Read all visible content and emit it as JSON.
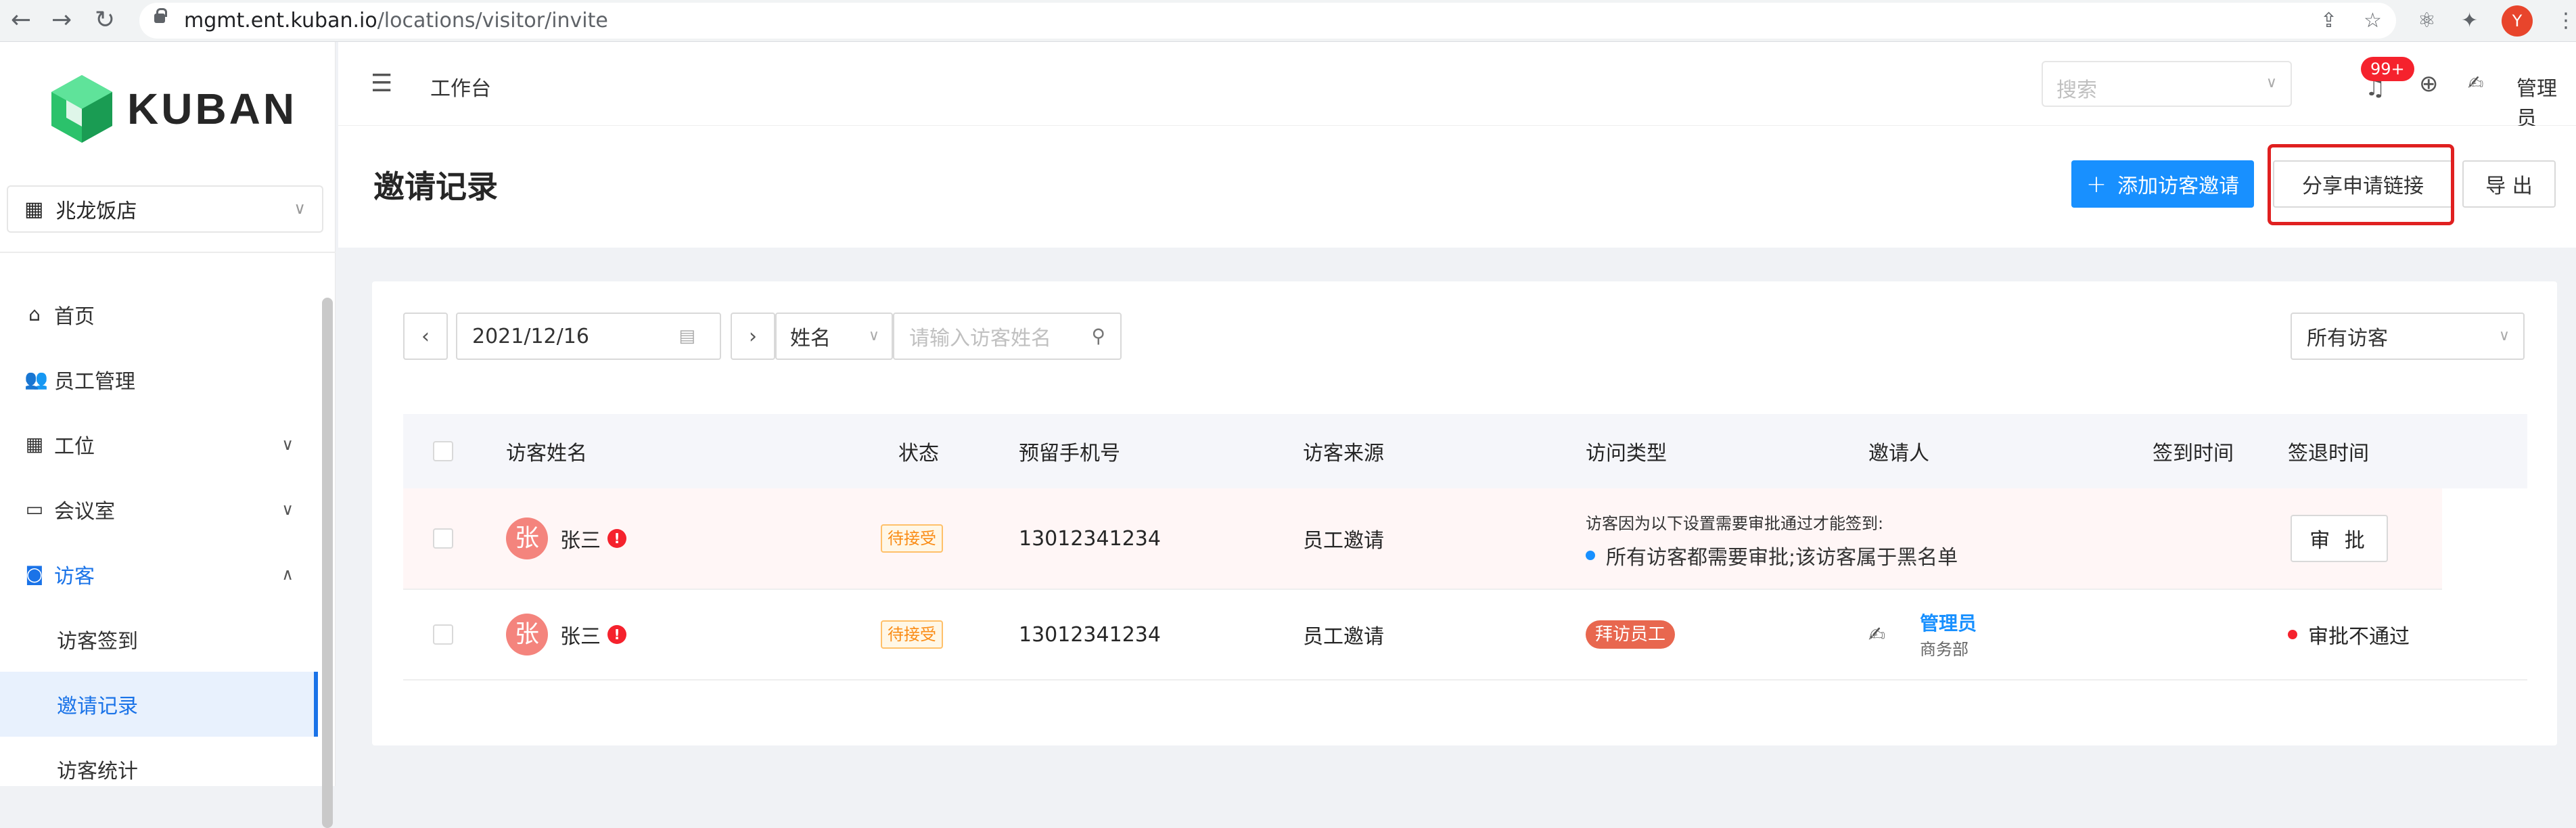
{
  "browser": {
    "url_host": "mgmt.ent.kuban.io",
    "url_path": "/locations/visitor/invite",
    "profile_initial": "Y",
    "back_icon": "←",
    "forward_icon": "→",
    "reload_icon": "↻",
    "share_icon": "⇪",
    "star_icon": "☆",
    "ext1_icon": "⚛",
    "ext2_icon": "✦",
    "menu_icon": "⋮"
  },
  "sidebar": {
    "logo_text": "KUBAN",
    "store": "兆龙饭店",
    "store_chevron": "∨",
    "items": [
      {
        "label": "首页",
        "icon": "⌂"
      },
      {
        "label": "员工管理",
        "icon": "👥"
      },
      {
        "label": "工位",
        "icon": "▦",
        "arrow": "∨"
      },
      {
        "label": "会议室",
        "icon": "▭",
        "arrow": "∨"
      },
      {
        "label": "访客",
        "icon": "◙",
        "arrow": "∧"
      }
    ],
    "sub_items": [
      {
        "label": "访客签到"
      },
      {
        "label": "邀请记录"
      },
      {
        "label": "访客统计"
      }
    ]
  },
  "topbar": {
    "collapse_icon": "☰",
    "breadcrumb": "工作台",
    "search_placeholder": "搜索",
    "search_chevron": "∨",
    "bell_icon": "♫",
    "badge": "99+",
    "globe_icon": "⊕",
    "avatar_icon": "✍",
    "user": "管理员"
  },
  "header": {
    "title": "邀请记录",
    "add_label": "添加访客邀请",
    "add_plus": "+",
    "share_label": "分享申请链接",
    "export_label": "导 出"
  },
  "filters": {
    "prev": "‹",
    "date": "2021/12/16",
    "calendar_icon": "▤",
    "next": "›",
    "field": "姓名",
    "field_chevron": "∨",
    "keyword_placeholder": "请输入访客姓名",
    "search_icon": "⚲",
    "visitor_filter": "所有访客",
    "visitor_chevron": "∨"
  },
  "table": {
    "columns": [
      "访客姓名",
      "状态",
      "预留手机号",
      "访客来源",
      "访问类型",
      "邀请人",
      "签到时间",
      "签退时间"
    ],
    "rows": [
      {
        "avatar": "张",
        "name": "张三",
        "alert": "!",
        "status": "待接受",
        "phone": "13012341234",
        "source": "员工邀请",
        "reason_title": "访客因为以下设置需要审批通过才能签到:",
        "reason_item": "所有访客都需要审批;该访客属于黑名单",
        "action": "审 批"
      },
      {
        "avatar": "张",
        "name": "张三",
        "alert": "!",
        "status": "待接受",
        "phone": "13012341234",
        "source": "员工邀请",
        "visit_type": "拜访员工",
        "inviter_icon": "✍",
        "inviter_name": "管理员",
        "inviter_dept": "商务部",
        "result": "审批不通过"
      }
    ]
  }
}
